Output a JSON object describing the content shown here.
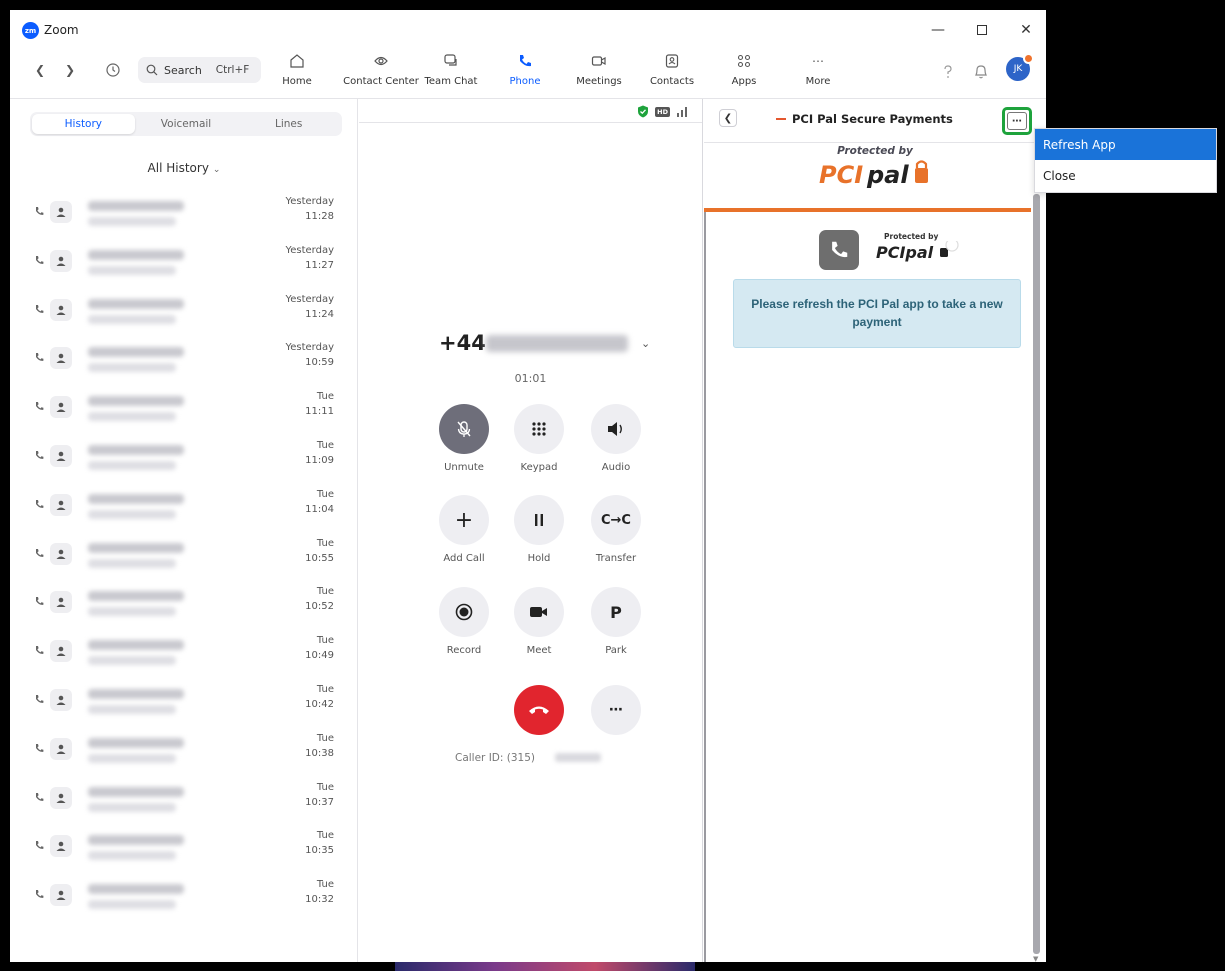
{
  "window": {
    "title": "Zoom",
    "logo_text": "zm"
  },
  "toolbar": {
    "search_label": "Search",
    "search_shortcut": "Ctrl+F",
    "avatar_initials": "JK",
    "nav": [
      {
        "label": "Home",
        "icon": "home-icon"
      },
      {
        "label": "Contact Center",
        "icon": "contact-center-icon"
      },
      {
        "label": "Team Chat",
        "icon": "team-chat-icon"
      },
      {
        "label": "Phone",
        "icon": "phone-icon",
        "active": true
      },
      {
        "label": "Meetings",
        "icon": "meetings-icon"
      },
      {
        "label": "Contacts",
        "icon": "contacts-icon"
      },
      {
        "label": "Apps",
        "icon": "apps-icon"
      },
      {
        "label": "More",
        "icon": "more-icon"
      }
    ]
  },
  "left": {
    "tabs": [
      {
        "label": "History",
        "active": true
      },
      {
        "label": "Voicemail"
      },
      {
        "label": "Lines"
      }
    ],
    "filter": "All History",
    "history": [
      {
        "day": "Yesterday",
        "time": "11:28"
      },
      {
        "day": "Yesterday",
        "time": "11:27"
      },
      {
        "day": "Yesterday",
        "time": "11:24"
      },
      {
        "day": "Yesterday",
        "time": "10:59"
      },
      {
        "day": "Tue",
        "time": "11:11"
      },
      {
        "day": "Tue",
        "time": "11:09"
      },
      {
        "day": "Tue",
        "time": "11:04"
      },
      {
        "day": "Tue",
        "time": "10:55"
      },
      {
        "day": "Tue",
        "time": "10:52"
      },
      {
        "day": "Tue",
        "time": "10:49"
      },
      {
        "day": "Tue",
        "time": "10:42"
      },
      {
        "day": "Tue",
        "time": "10:38"
      },
      {
        "day": "Tue",
        "time": "10:37"
      },
      {
        "day": "Tue",
        "time": "10:35"
      },
      {
        "day": "Tue",
        "time": "10:32"
      }
    ]
  },
  "call": {
    "number_prefix": "+44",
    "timer": "01:01",
    "controls": [
      {
        "label": "Unmute"
      },
      {
        "label": "Keypad"
      },
      {
        "label": "Audio"
      },
      {
        "label": "Add Call"
      },
      {
        "label": "Hold"
      },
      {
        "label": "Transfer"
      },
      {
        "label": "Record"
      },
      {
        "label": "Meet"
      },
      {
        "label": "Park"
      }
    ],
    "caller_id_label": "Caller ID: (315)",
    "hd_badge": "HD"
  },
  "app_panel": {
    "title": "PCI Pal Secure Payments",
    "protected_by": "Protected by",
    "brand": "PCIpal",
    "message": "Please refresh the PCI Pal app to take a new payment"
  },
  "menu": {
    "items": [
      "Refresh App",
      "Close"
    ]
  },
  "colors": {
    "accent": "#0b5cff",
    "end_call": "#e1252e",
    "highlight_border": "#1ea33c",
    "menu_highlight": "#1a73d9",
    "pci_orange": "#e8722a",
    "alert_bg": "#d5e9f2"
  }
}
